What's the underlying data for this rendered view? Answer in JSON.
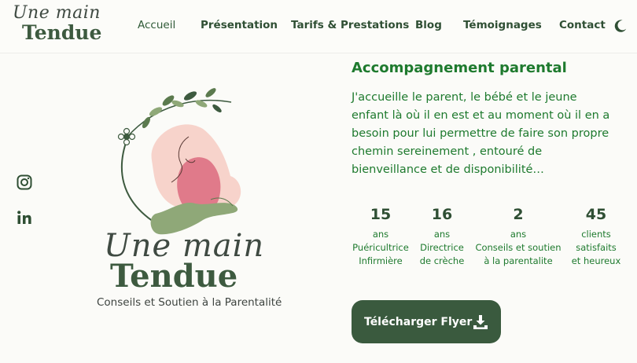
{
  "header": {
    "logo_script": "Une main",
    "logo_brand": "Tendue",
    "nav": [
      {
        "label": "Accueil",
        "active": true
      },
      {
        "label": "Présentation"
      },
      {
        "label": "Tarifs & Prestations"
      },
      {
        "label": "Blog"
      },
      {
        "label": "Témoignages"
      },
      {
        "label": "Contact"
      }
    ],
    "theme_toggle_icon": "moon-icon"
  },
  "social": [
    {
      "icon": "instagram-icon"
    },
    {
      "icon": "linkedin-icon"
    }
  ],
  "hero": {
    "logo_script": "Une main",
    "logo_brand": "Tendue",
    "tagline": "Conseils et Soutien à la Parentalité"
  },
  "main": {
    "title": "Accompagnement parental",
    "intro_lines": [
      "J'accueille le parent, le bébé et le jeune",
      "enfant là où il en est et au moment où il en a",
      "besoin pour lui permettre de faire son propre",
      "chemin sereinement , entouré de",
      "bienveillance et de disponibilité…"
    ],
    "stats": [
      {
        "value": "15",
        "lines": [
          "ans",
          "Puéricultrice",
          "Infirmière"
        ]
      },
      {
        "value": "16",
        "lines": [
          "ans",
          "Directrice",
          "de crèche"
        ]
      },
      {
        "value": "2",
        "lines": [
          "ans",
          "Conseils et soutien",
          "à la parentalite"
        ]
      },
      {
        "value": "45",
        "lines": [
          "clients",
          "satisfaits",
          "et heureux"
        ]
      }
    ],
    "download_label": "Télécharger Flyer",
    "download_icon": "download-icon"
  },
  "colors": {
    "accent_green": "#1e7a2e",
    "dark_green": "#3a5a3e",
    "pink": "#e07a8a",
    "background": "#fbfbf8"
  }
}
